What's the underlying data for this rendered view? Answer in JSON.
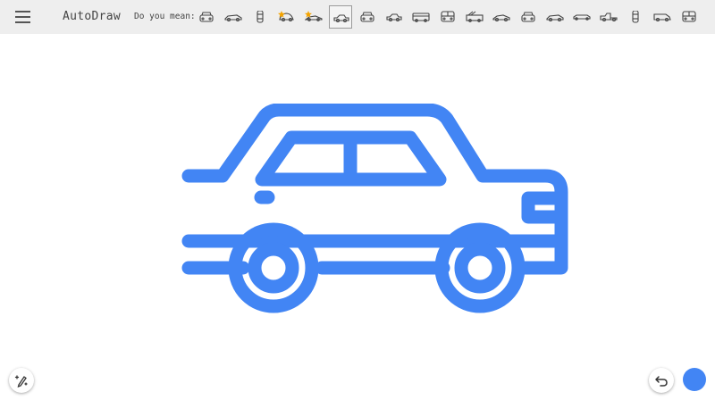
{
  "app": {
    "title": "AutoDraw"
  },
  "toolbar": {
    "menu_icon": "hamburger-menu-icon",
    "suggestions_label": "Do you mean:"
  },
  "suggestions": [
    {
      "icon": "car-front-icon",
      "starred": false,
      "selected": false
    },
    {
      "icon": "race-car-icon",
      "starred": false,
      "selected": false
    },
    {
      "icon": "car-topview-icon",
      "starred": false,
      "selected": false
    },
    {
      "icon": "beetle-car-icon",
      "starred": true,
      "selected": false
    },
    {
      "icon": "sports-car-outline-icon",
      "starred": true,
      "selected": false
    },
    {
      "icon": "sedan-car-icon",
      "starred": false,
      "selected": true
    },
    {
      "icon": "car-front-icon",
      "starred": false,
      "selected": false
    },
    {
      "icon": "sedan-car-icon",
      "starred": false,
      "selected": false
    },
    {
      "icon": "bus-icon",
      "starred": false,
      "selected": false
    },
    {
      "icon": "bus-front-icon",
      "starred": false,
      "selected": false
    },
    {
      "icon": "fire-truck-icon",
      "starred": false,
      "selected": false
    },
    {
      "icon": "sports-car-icon",
      "starred": false,
      "selected": false
    },
    {
      "icon": "car-front-icon",
      "starred": false,
      "selected": false
    },
    {
      "icon": "race-car-icon",
      "starred": false,
      "selected": false
    },
    {
      "icon": "limousine-icon",
      "starred": false,
      "selected": false
    },
    {
      "icon": "tow-truck-icon",
      "starred": false,
      "selected": false
    },
    {
      "icon": "car-topview-icon",
      "starred": false,
      "selected": false
    },
    {
      "icon": "van-icon",
      "starred": false,
      "selected": false
    },
    {
      "icon": "bus-front-icon",
      "starred": false,
      "selected": false
    }
  ],
  "canvas": {
    "drawing_icon": "sedan-car-icon",
    "stroke_color": "#4285f4"
  },
  "tools": {
    "autodraw_tool_icon": "autodraw-pencil-sparkle-icon",
    "undo_icon": "undo-icon",
    "fill_color": "#4285f4"
  },
  "colors": {
    "toolbar_bg": "#eeeeee",
    "icon_stroke": "#444444",
    "star": "#f4a300",
    "accent": "#4285f4"
  }
}
